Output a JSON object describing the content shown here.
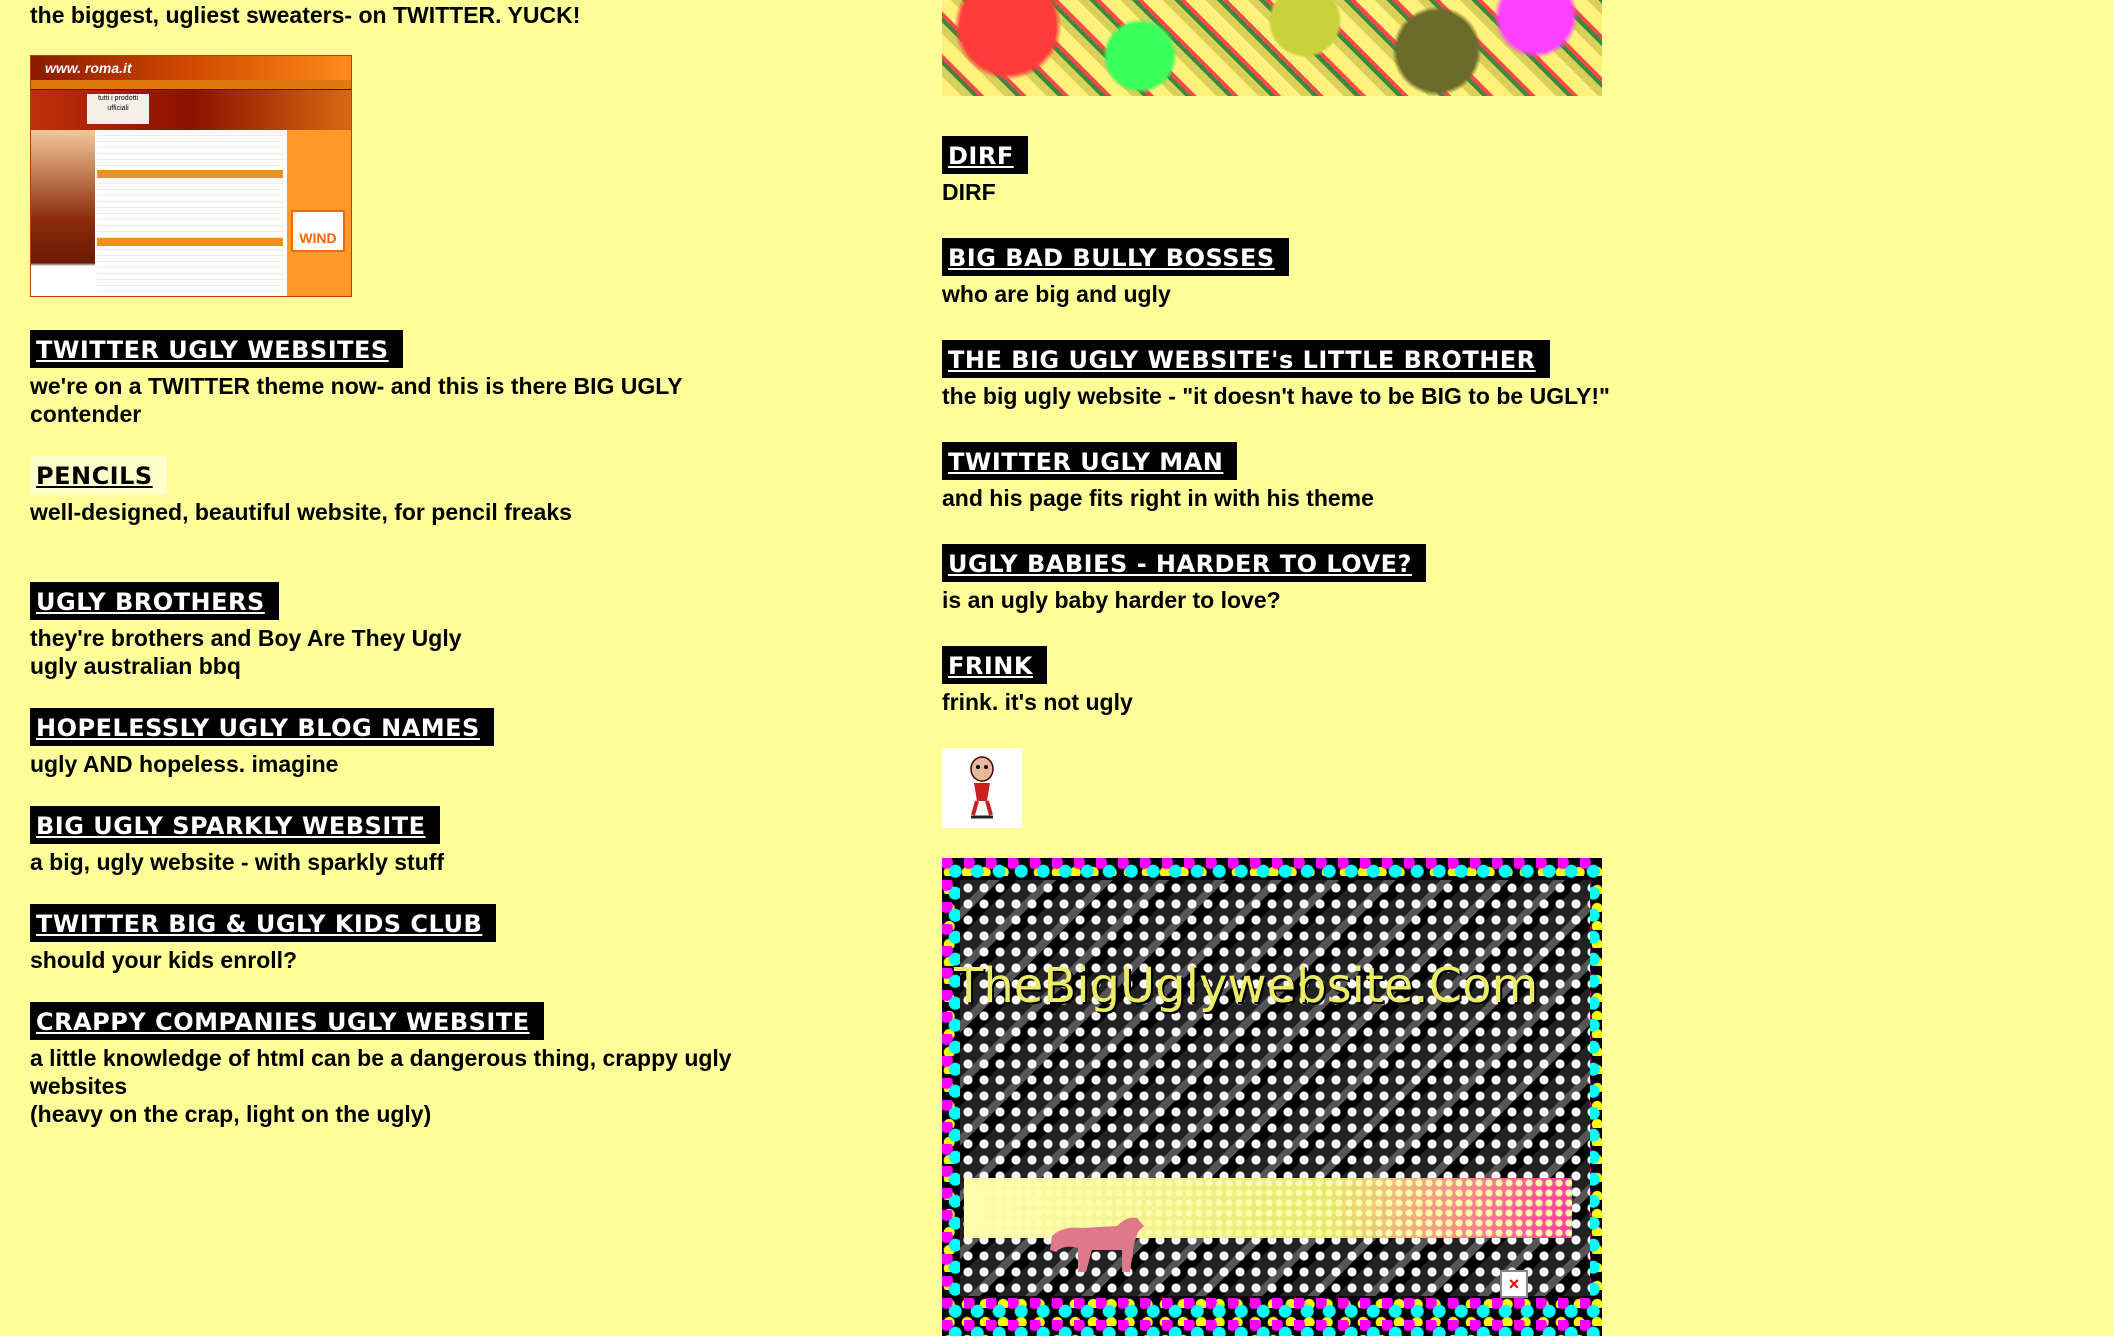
{
  "intro": "the biggest, ugliest sweaters- on TWITTER. YUCK!",
  "roma_thumb": {
    "logo": "www. roma.it",
    "box": "tutti i prodotti ufficiali",
    "sponsor": "WIND"
  },
  "left_entries": [
    {
      "title": "TWITTER UGLY WEBSITES",
      "desc": "we're on a TWITTER theme now- and this is there BIG UGLY\ncontender"
    },
    {
      "title": "PENCILS",
      "desc": "well-designed, beautiful website, for pencil freaks"
    },
    {
      "title": "UGLY BROTHERS",
      "desc": "they're brothers and Boy Are They Ugly\nugly australian bbq"
    },
    {
      "title": "HOPELESSLY UGLY BLOG NAMES",
      "desc": "ugly AND hopeless. imagine"
    },
    {
      "title": "BIG UGLY SPARKLY WEBSITE",
      "desc": "a big, ugly website - with sparkly stuff"
    },
    {
      "title": "TWITTER BIG & UGLY KIDS CLUB",
      "desc": "should your kids enroll?"
    },
    {
      "title": "CRAPPY COMPANIES UGLY WEBSITE",
      "desc": "a little knowledge of html can be a dangerous thing, crappy ugly\nwebsites\n(heavy on the crap, light on the ugly)"
    }
  ],
  "right_entries": [
    {
      "title": "DIRF",
      "desc": "DIRF"
    },
    {
      "title": "BIG BAD BULLY BOSSES",
      "desc": "who are big and ugly"
    },
    {
      "title": "THE BIG UGLY WEBSITE's LITTLE BROTHER",
      "desc": "the big ugly website - \"it doesn't have to be BIG to be UGLY!\""
    },
    {
      "title": "TWITTER UGLY MAN",
      "desc": "and his page fits right in with his theme"
    },
    {
      "title": "UGLY BABIES - HARDER TO LOVE?",
      "desc": "is an ugly baby harder to love?"
    },
    {
      "title": "FRINK",
      "desc": "frink. it's not ugly"
    }
  ],
  "banner": {
    "title": "TheBigUglywebsite.Com",
    "close_glyph": "×"
  },
  "colors": {
    "background": "#ffff99",
    "button_bg": "#000000",
    "button_text": "#ffffff",
    "pencils_bg": "#ffffcc"
  },
  "icons": [
    "doll-figure-icon",
    "dog-silhouette-icon",
    "close-box-icon"
  ]
}
